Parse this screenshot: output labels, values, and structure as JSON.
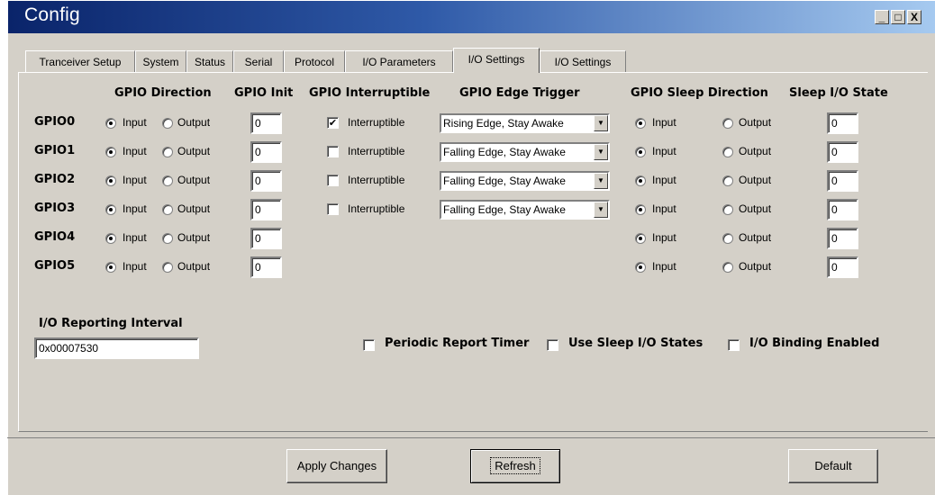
{
  "window": {
    "title": "Config",
    "minimize": "_",
    "maximize": "□",
    "close": "X"
  },
  "tabs": [
    {
      "label": "Tranceiver Setup"
    },
    {
      "label": "System"
    },
    {
      "label": "Status"
    },
    {
      "label": "Serial"
    },
    {
      "label": "Protocol"
    },
    {
      "label": "I/O Parameters"
    },
    {
      "label": "I/O Settings",
      "active": true
    },
    {
      "label": "I/O Settings"
    }
  ],
  "headers": {
    "direction": "GPIO Direction",
    "init": "GPIO Init",
    "interruptible": "GPIO Interruptible",
    "edge": "GPIO Edge Trigger",
    "sleep_direction": "GPIO Sleep Direction",
    "sleep_state": "Sleep I/O State"
  },
  "option_labels": {
    "input": "Input",
    "output": "Output",
    "interruptible": "Interruptible"
  },
  "gpios": [
    {
      "name": "GPIO0",
      "direction": "Input",
      "init": "0",
      "interruptible": true,
      "edge": "Rising Edge, Stay Awake",
      "sleep_direction": "Input",
      "sleep_state": "0"
    },
    {
      "name": "GPIO1",
      "direction": "Input",
      "init": "0",
      "interruptible": false,
      "edge": "Falling Edge, Stay Awake",
      "sleep_direction": "Input",
      "sleep_state": "0"
    },
    {
      "name": "GPIO2",
      "direction": "Input",
      "init": "0",
      "interruptible": false,
      "edge": "Falling Edge, Stay Awake",
      "sleep_direction": "Input",
      "sleep_state": "0"
    },
    {
      "name": "GPIO3",
      "direction": "Input",
      "init": "0",
      "interruptible": false,
      "edge": "Falling Edge, Stay Awake",
      "sleep_direction": "Input",
      "sleep_state": "0"
    },
    {
      "name": "GPIO4",
      "direction": "Input",
      "init": "0",
      "sleep_direction": "Input",
      "sleep_state": "0"
    },
    {
      "name": "GPIO5",
      "direction": "Input",
      "init": "0",
      "sleep_direction": "Input",
      "sleep_state": "0"
    }
  ],
  "reporting": {
    "label": "I/O Reporting Interval",
    "value": "0x00007530"
  },
  "options": {
    "periodic_report_timer": {
      "label": "Periodic Report Timer",
      "checked": false
    },
    "use_sleep_io_states": {
      "label": "Use Sleep I/O States",
      "checked": false
    },
    "io_binding_enabled": {
      "label": "I/O Binding Enabled",
      "checked": false
    }
  },
  "buttons": {
    "apply": "Apply Changes",
    "refresh": "Refresh",
    "default": "Default"
  },
  "colors": {
    "title_start": "#0a246a",
    "title_end": "#a6caf0",
    "face": "#d4d0c8"
  }
}
